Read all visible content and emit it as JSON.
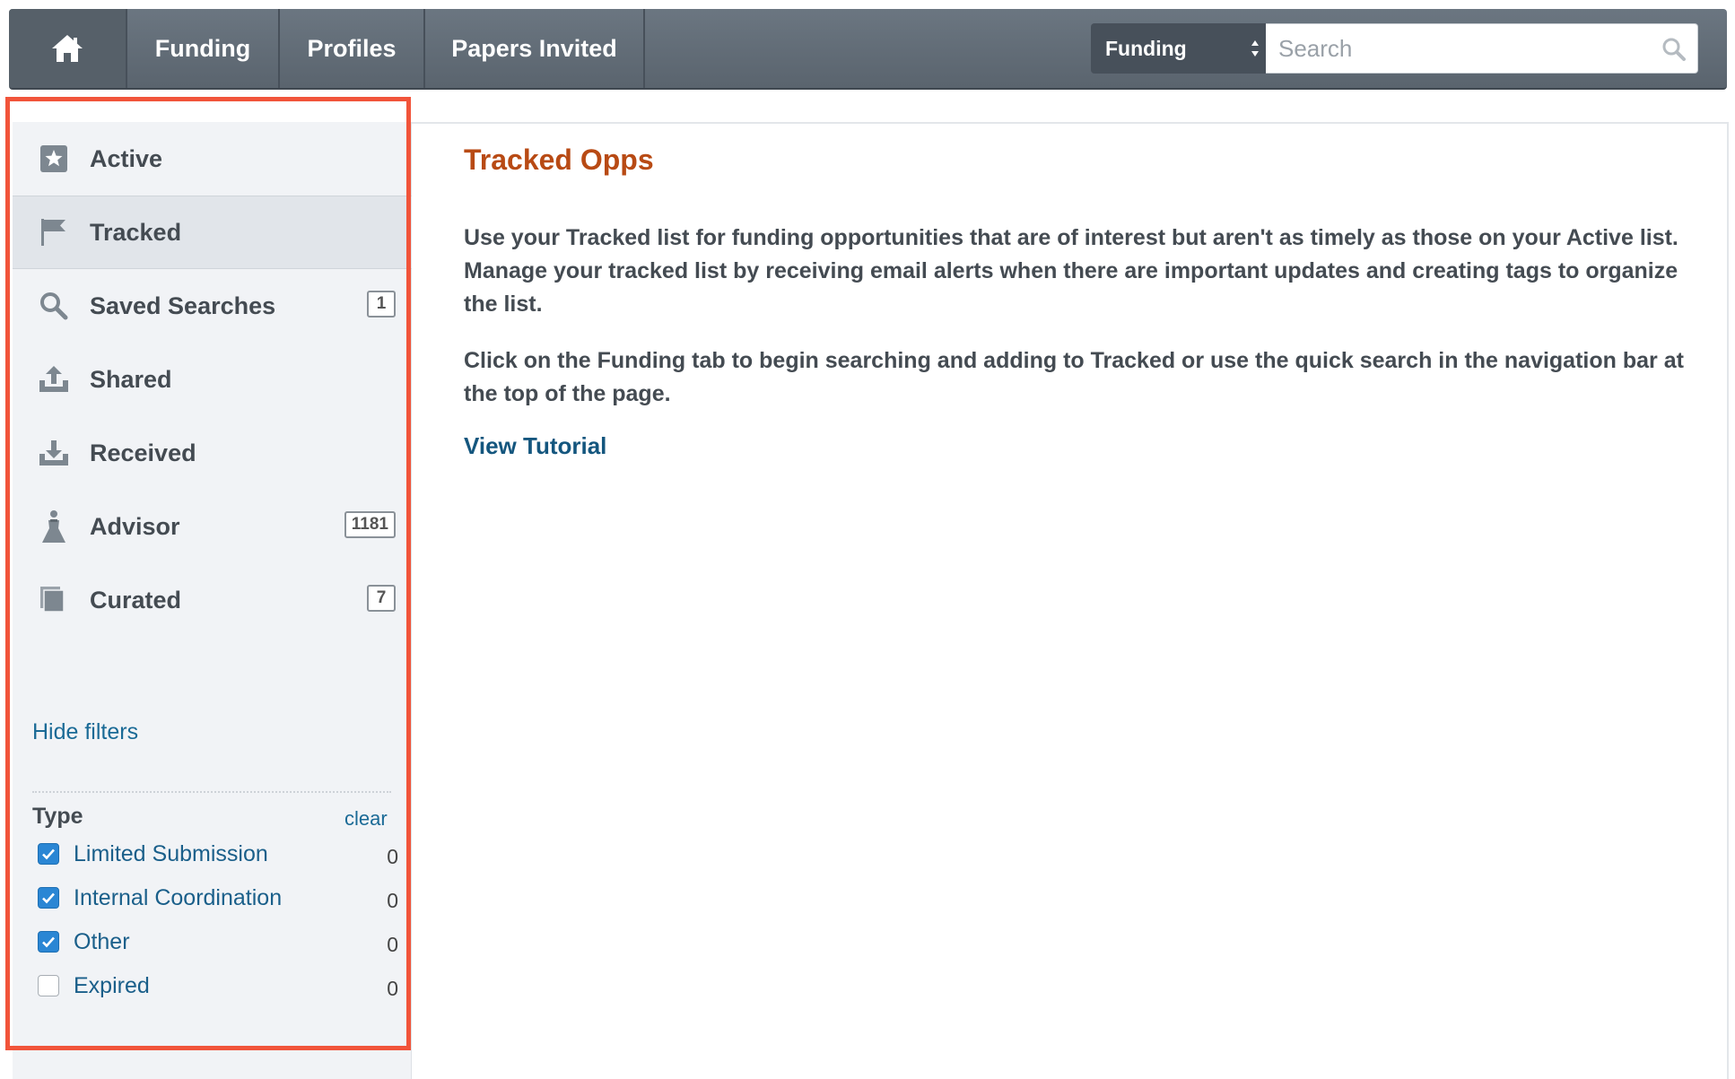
{
  "nav": {
    "tabs": [
      "Funding",
      "Profiles",
      "Papers Invited"
    ],
    "search_scope": "Funding",
    "search_placeholder": "Search"
  },
  "sidebar": {
    "items": [
      {
        "label": "Active",
        "icon": "star-icon"
      },
      {
        "label": "Tracked",
        "icon": "flag-icon",
        "active": true
      },
      {
        "label": "Saved Searches",
        "icon": "search-icon",
        "badge": "1"
      },
      {
        "label": "Shared",
        "icon": "share-upload-icon"
      },
      {
        "label": "Received",
        "icon": "inbox-download-icon"
      },
      {
        "label": "Advisor",
        "icon": "advisor-person-icon",
        "badge": "1181"
      },
      {
        "label": "Curated",
        "icon": "documents-stack-icon",
        "badge": "7"
      }
    ],
    "hide_filters": "Hide filters",
    "filters": {
      "title": "Type",
      "clear": "clear",
      "options": [
        {
          "label": "Limited Submission",
          "checked": true,
          "count": "0"
        },
        {
          "label": "Internal Coordination",
          "checked": true,
          "count": "0"
        },
        {
          "label": "Other",
          "checked": true,
          "count": "0"
        },
        {
          "label": "Expired",
          "checked": false,
          "count": "0"
        }
      ]
    }
  },
  "main": {
    "title": "Tracked Opps",
    "paragraph1": "Use your Tracked list for funding opportunities that are of interest but aren't as timely as those on your Active list. Manage your tracked list by receiving email alerts when there are important updates and creating tags to organize the list.",
    "paragraph2": "Click on the Funding tab to begin searching and adding to Tracked or use the quick search in the navigation bar at the top of the page.",
    "tutorial_link": "View Tutorial"
  },
  "colors": {
    "nav_bg": "#5f6a74",
    "sidebar_bg": "#f1f3f6",
    "highlight": "#f1543a",
    "title": "#b84a14",
    "link": "#1a6a96",
    "checkbox": "#2a86d4"
  }
}
